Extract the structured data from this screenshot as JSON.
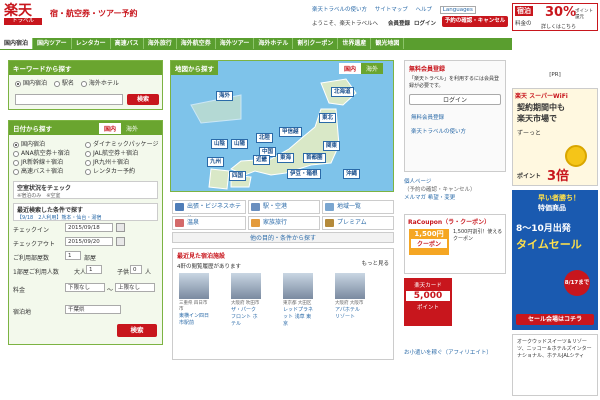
{
  "logo": {
    "kanji": "楽天",
    "sub": "トラベル"
  },
  "tagline": "宿・航空券・ツアー予約",
  "top_links": [
    "楽天トラベルの使い方",
    "サイトマップ",
    "ヘルプ",
    "Languages"
  ],
  "welcome": "ようこそ、楽天トラベルへ",
  "member_reg": "会員登録",
  "login": "ログイン",
  "reserve_btn": "予約の確認・キャンセル",
  "promo_top": {
    "line1": "宿泊",
    "line2": "料金の",
    "big": "30%",
    "line3": "ポイント還元",
    "line4": "詳しくはこちら"
  },
  "nav": [
    "国内宿泊",
    "国内ツアー",
    "レンタカー",
    "高速バス",
    "海外旅行",
    "海外航空券",
    "海外ツアー",
    "海外ホテル",
    "割引クーポン",
    "世界遺産",
    "観光地図"
  ],
  "keyword": {
    "title": "キーワードから探す",
    "options": [
      "国内宿泊",
      "駅名",
      "海外ホテル"
    ],
    "search": "検索"
  },
  "date": {
    "title": "日付から探す",
    "tabs": [
      "国内",
      "海外"
    ],
    "opts": [
      "国内宿泊",
      "ANA航空券＋宿泊",
      "JR新幹線＋宿泊",
      "高速バス＋宿泊",
      "ダイナミックパッケージ",
      "JAL航空券＋宿泊",
      "JR九州＋宿泊",
      "レンタカー予約"
    ],
    "vacancy": "空室状況をチェック",
    "vacancy_sub": "※宿泊のみ　※空室",
    "recent": "最近検索した条件で探す",
    "recent_val": "【9/18　2人利用】熊本・仙台・湯宿",
    "checkin_label": "チェックイン",
    "checkin": "2015/09/18",
    "checkout_label": "チェックアウト",
    "checkout": "2015/09/20",
    "nights_label": "ご利用部屋数",
    "nights": "1",
    "nights_unit": "部屋",
    "people_label": "1部屋ご利用人数",
    "adults": "1",
    "adults_unit": "大人",
    "child": "0",
    "child_unit": "子供",
    "child_u2": "人",
    "price_label": "料金",
    "price_min": "下限なし",
    "price_max": "上限なし",
    "pref_label": "宿泊地",
    "pref": "千葉県",
    "search": "検索"
  },
  "map": {
    "title": "地図から探す",
    "tabs": [
      "国内",
      "海外"
    ],
    "regions": [
      "北海道",
      "海外",
      "東北",
      "関東",
      "北陸",
      "甲信越",
      "山陰",
      "山陽",
      "中国",
      "近畿",
      "東海",
      "首都圏",
      "九州",
      "四国",
      "伊豆・箱根",
      "沖縄"
    ]
  },
  "categories": [
    "出張・ビジネスホテル",
    "駅・空港",
    "地域一覧",
    "温泉",
    "家族旅行",
    "プレミアム"
  ],
  "category_more": "他の目的・条件から探す",
  "recent_hotels": {
    "title": "最近見た宿泊施設",
    "count": "4軒の閲覧履歴があります",
    "more": "もっと見る",
    "items": [
      {
        "area": "三重県 四日市市",
        "name": "東横イン四日市駅前"
      },
      {
        "area": "大阪府 吹田市",
        "name": "ザ・パーク フロント ホテル"
      },
      {
        "area": "東京都 大田区",
        "name": "レッドプラネット 浅草 東京"
      },
      {
        "area": "大阪府 大阪市",
        "name": "アパホテル リゾート"
      }
    ]
  },
  "sidebar": {
    "member_title": "無料会員登録",
    "member_desc": "「楽天トラベル」を利用するには会員登録が必要です。",
    "login": "ログイン",
    "links": [
      "無料会員登録",
      "楽天トラベルの使い方"
    ],
    "my_page": "個人ページ",
    "my_sub": "（予約の確認・キャンセル）",
    "mail": "メルマガ 希望・変更",
    "coupon_title": "RaCoupon（ラ・クーポン）",
    "coupon_price": "1,500円",
    "coupon_label": "クーポン",
    "coupon_desc": "1,500円割引！使えるクーポン",
    "card_label": "楽天カード",
    "card_big": "5,000",
    "card_sub": "ポイント",
    "point": "ポイント",
    "affil": "お小遣いを稼ぐ（アフィリエイト）"
  },
  "ads": {
    "pr": "[PR]",
    "wifi": {
      "title": "楽天 スーパーWiFi",
      "line1": "契約期間中も",
      "line2": "楽天市場で",
      "line3": "ずーっと",
      "line4": "ポイント",
      "big": "3倍"
    },
    "ana": {
      "title": "早い者勝ち！",
      "title2": "特価商品",
      "big": "8〜10月出発",
      "sale": "タイムセール",
      "date": "8/17まで",
      "more": "セール会場はコチラ"
    },
    "jal": {
      "text": "オークウッドスイーツ＆リゾーツ、ニッコー＆ホテルズインターナショナル、ホテルJALシティ"
    }
  },
  "colors": {
    "green": "#5a9e2f",
    "red": "#c8161d",
    "blue": "#2a6aa8",
    "map_sea": "#7ec3ea"
  }
}
